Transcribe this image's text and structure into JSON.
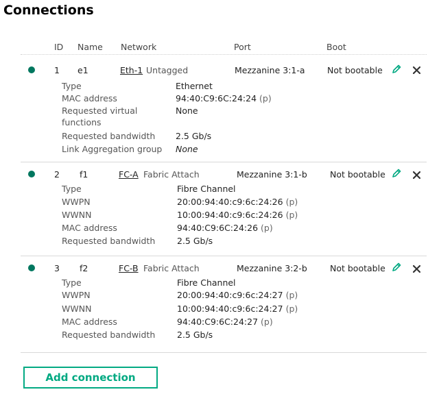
{
  "page": {
    "title": "Connections"
  },
  "columns": {
    "id": "ID",
    "name": "Name",
    "network": "Network",
    "port": "Port",
    "boot": "Boot"
  },
  "colors": {
    "status_ok": "#00775f",
    "accent": "#01a982"
  },
  "connections": [
    {
      "id": "1",
      "name": "e1",
      "network": "Eth-1",
      "network_type": "Untagged",
      "port": "Mezzanine 3:1-a",
      "boot": "Not bootable",
      "details": {
        "type_label": "Type",
        "type_value": "Ethernet",
        "mac_label": "MAC address",
        "mac_value": "94:40:C9:6C:24:24",
        "mac_suffix": "(p)",
        "rvf_label_1": "Requested virtual",
        "rvf_label_2": "functions",
        "rvf_value": "None",
        "bw_label": "Requested bandwidth",
        "bw_value": "2.5 Gb/s",
        "lag_label": "Link Aggregation group",
        "lag_value": "None"
      }
    },
    {
      "id": "2",
      "name": "f1",
      "network": "FC-A",
      "network_type": "Fabric Attach",
      "port": "Mezzanine 3:1-b",
      "boot": "Not bootable",
      "details": {
        "type_label": "Type",
        "type_value": "Fibre Channel",
        "wwpn_label": "WWPN",
        "wwpn_value": "20:00:94:40:c9:6c:24:26",
        "wwpn_suffix": "(p)",
        "wwnn_label": "WWNN",
        "wwnn_value": "10:00:94:40:c9:6c:24:26",
        "wwnn_suffix": "(p)",
        "mac_label": "MAC address",
        "mac_value": "94:40:C9:6C:24:26",
        "mac_suffix": "(p)",
        "bw_label": "Requested bandwidth",
        "bw_value": "2.5 Gb/s"
      }
    },
    {
      "id": "3",
      "name": "f2",
      "network": "FC-B",
      "network_type": "Fabric Attach",
      "port": "Mezzanine 3:2-b",
      "boot": "Not bootable",
      "details": {
        "type_label": "Type",
        "type_value": "Fibre Channel",
        "wwpn_label": "WWPN",
        "wwpn_value": "20:00:94:40:c9:6c:24:27",
        "wwpn_suffix": "(p)",
        "wwnn_label": "WWNN",
        "wwnn_value": "10:00:94:40:c9:6c:24:27",
        "wwnn_suffix": "(p)",
        "mac_label": "MAC address",
        "mac_value": "94:40:C9:6C:24:27",
        "mac_suffix": "(p)",
        "bw_label": "Requested bandwidth",
        "bw_value": "2.5 Gb/s"
      }
    }
  ],
  "actions": {
    "add_connection": "Add connection"
  },
  "icons": {
    "edit": "pencil-icon",
    "remove": "close-icon"
  }
}
